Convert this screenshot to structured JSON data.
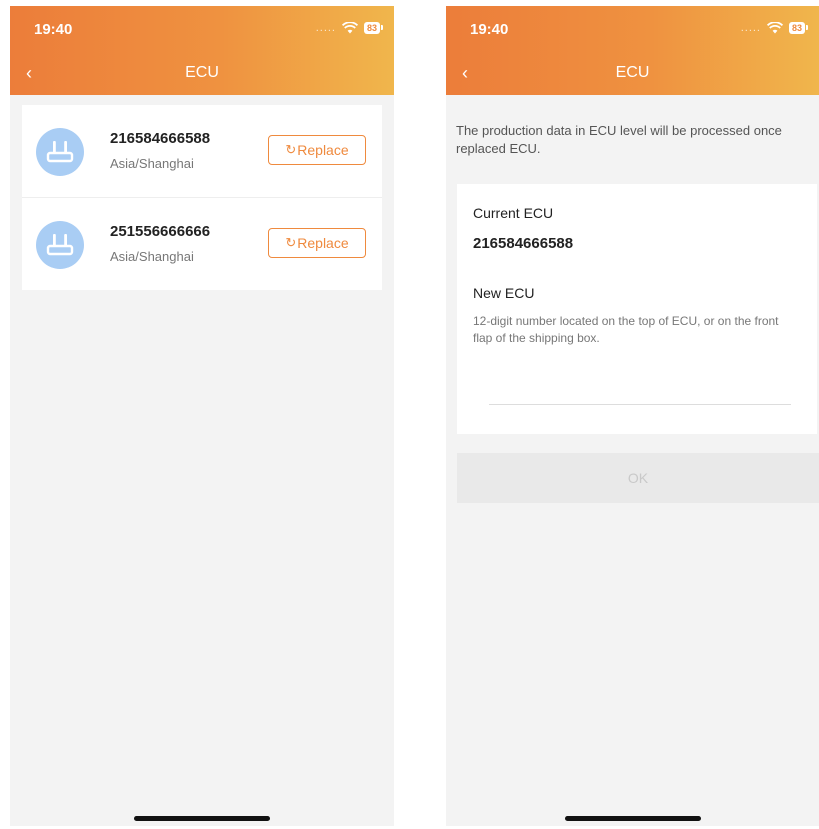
{
  "colors": {
    "header_start": "#ec7d3a",
    "header_end": "#f0b64c",
    "accent": "#ef8a3e",
    "avatar_bg": "#a9cdf4"
  },
  "left_screen": {
    "status": {
      "time": "19:40",
      "battery": "83",
      "signal_dots": "....."
    },
    "nav": {
      "back_icon": "chevron-left-icon",
      "back_glyph": "‹",
      "title": "ECU"
    },
    "ecu_list": [
      {
        "serial": "216584666588",
        "timezone": "Asia/Shanghai",
        "replace_label": "Replace",
        "icon": "router-icon"
      },
      {
        "serial": "251556666666",
        "timezone": "Asia/Shanghai",
        "replace_label": "Replace",
        "icon": "router-icon"
      }
    ]
  },
  "right_screen": {
    "status": {
      "time": "19:40",
      "battery": "83",
      "signal_dots": "....."
    },
    "nav": {
      "back_icon": "chevron-left-icon",
      "back_glyph": "‹",
      "title": "ECU"
    },
    "intro": "The production data in ECU level will be processed once replaced ECU.",
    "current_ecu_label": "Current ECU",
    "current_ecu_value": "216584666588",
    "new_ecu_label": "New ECU",
    "new_ecu_hint": "12-digit number located on the top of ECU, or on the front flap of the shipping box.",
    "new_ecu_value": "",
    "ok_label": "OK"
  }
}
